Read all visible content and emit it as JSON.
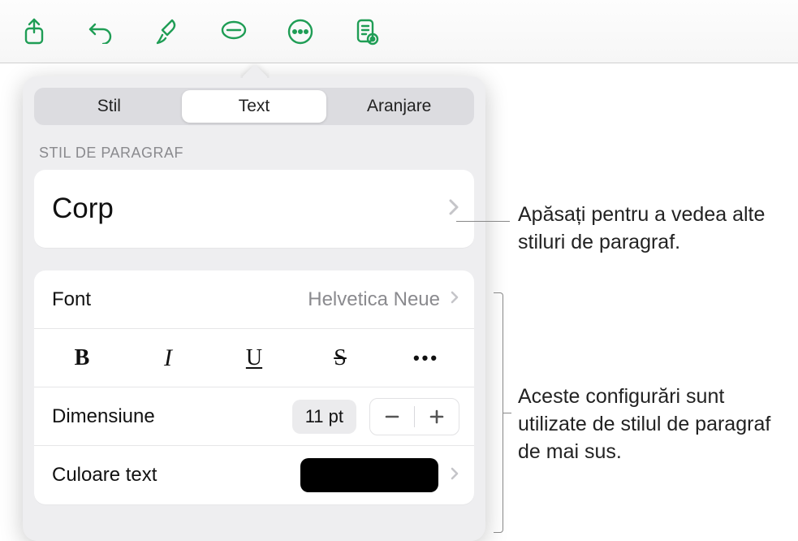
{
  "toolbar": {
    "icons": [
      "share-icon",
      "undo-icon",
      "format-brush-icon",
      "comment-icon",
      "more-icon",
      "reading-icon"
    ]
  },
  "popover": {
    "tabs": {
      "style": "Stil",
      "text": "Text",
      "arrange": "Aranjare",
      "selected": 1
    },
    "section_label": "STIL DE PARAGRAF",
    "paragraph_style": "Corp",
    "font": {
      "label": "Font",
      "value": "Helvetica Neue"
    },
    "style_buttons": {
      "bold": "B",
      "italic": "I",
      "underline": "U",
      "strike": "S",
      "more": "•••"
    },
    "size": {
      "label": "Dimensiune",
      "value": "11 pt"
    },
    "text_color": {
      "label": "Culoare text",
      "value_hex": "#000000"
    }
  },
  "callouts": {
    "c1": "Apăsați pentru a vedea alte stiluri de paragraf.",
    "c2": "Aceste configurări sunt utilizate de stilul de paragraf de mai sus."
  }
}
